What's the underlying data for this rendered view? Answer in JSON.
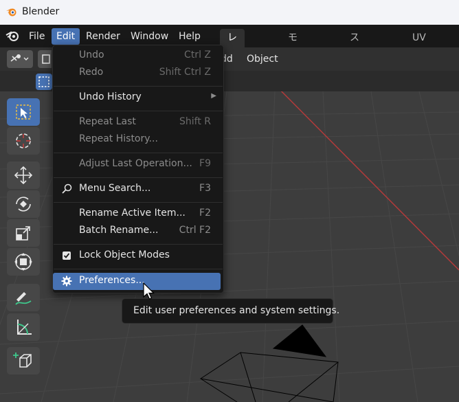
{
  "window": {
    "title": "Blender"
  },
  "menubar": {
    "items": [
      "File",
      "Edit",
      "Render",
      "Window",
      "Help"
    ],
    "active": "Edit"
  },
  "workspaces": {
    "tabs": [
      "レイアウト",
      "モデリング",
      "スカルプト",
      "UV編集"
    ],
    "active": "レイアウト"
  },
  "header": {
    "add_label": "dd",
    "object_label": "Object"
  },
  "edit_menu": {
    "items": [
      {
        "label": "Undo",
        "shortcut": "Ctrl Z",
        "disabled": true
      },
      {
        "label": "Redo",
        "shortcut": "Shift Ctrl Z",
        "disabled": true
      },
      {
        "label": "Undo History",
        "shortcut": "",
        "submenu": true
      },
      {
        "label": "Repeat Last",
        "shortcut": "Shift R",
        "disabled": true
      },
      {
        "label": "Repeat History...",
        "shortcut": "",
        "disabled": true
      },
      {
        "label": "Adjust Last Operation...",
        "shortcut": "F9",
        "disabled": true
      },
      {
        "label": "Menu Search...",
        "shortcut": "F3",
        "icon": "search-icon"
      },
      {
        "label": "Rename Active Item...",
        "shortcut": "F2"
      },
      {
        "label": "Batch Rename...",
        "shortcut": "Ctrl F2"
      },
      {
        "label": "Lock Object Modes",
        "shortcut": "",
        "checked": true
      },
      {
        "label": "Preferences...",
        "shortcut": "",
        "icon": "gear-icon",
        "highlighted": true
      }
    ]
  },
  "tooltip": {
    "text": "Edit user preferences and system settings."
  },
  "colors": {
    "accent": "#4772b3",
    "menu_bg": "#181818",
    "viewport_bg": "#3d3d3d",
    "x_axis": "#b33a3a"
  }
}
